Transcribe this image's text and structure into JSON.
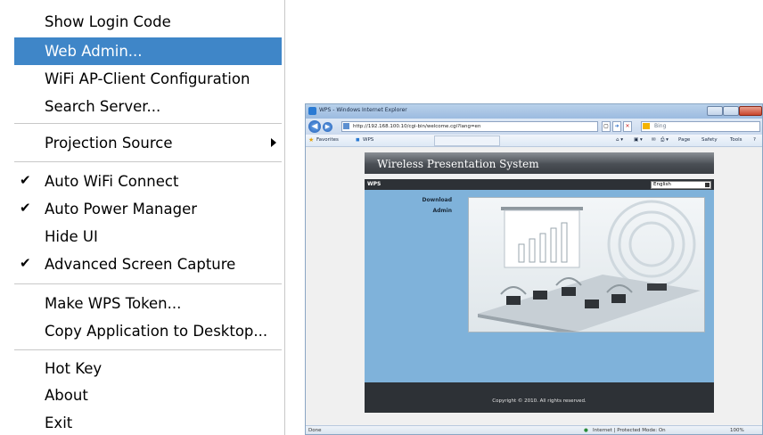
{
  "menu": {
    "items": [
      {
        "label": "Show Login Code"
      },
      {
        "label": "Web Admin...",
        "highlighted": true
      },
      {
        "label": "WiFi AP-Client Configuration"
      },
      {
        "label": "Search Server..."
      },
      {
        "label": "Projection Source",
        "submenu": true
      },
      {
        "label": "Auto WiFi Connect",
        "checked": true
      },
      {
        "label": "Auto Power Manager",
        "checked": true
      },
      {
        "label": "Hide UI"
      },
      {
        "label": "Advanced Screen Capture",
        "checked": true
      },
      {
        "label": "Make WPS Token..."
      },
      {
        "label": "Copy Application to Desktop..."
      },
      {
        "label": "Hot Key"
      },
      {
        "label": "About"
      },
      {
        "label": "Exit"
      }
    ],
    "check_glyph": "✔",
    "highlight_color": "#3f86c8"
  },
  "browser": {
    "title": "WPS - Windows Internet Explorer",
    "url": "http://192.168.100.10/cgi-bin/welcome.cgi?lang=en",
    "search_placeholder": "Bing",
    "favorites_label": "Favorites",
    "tab_label": "WPS",
    "commands": {
      "page": "Page",
      "safety": "Safety",
      "tools": "Tools"
    },
    "status_left": "Done",
    "status_right": "Internet | Protected Mode: On",
    "zoom": "100%"
  },
  "wps_page": {
    "banner_title": "Wireless Presentation System",
    "bar_label": "WPS",
    "language": "English",
    "nav": [
      {
        "label": "Download"
      },
      {
        "label": "Admin"
      }
    ],
    "footer": "Copyright © 2010. All rights reserved."
  }
}
